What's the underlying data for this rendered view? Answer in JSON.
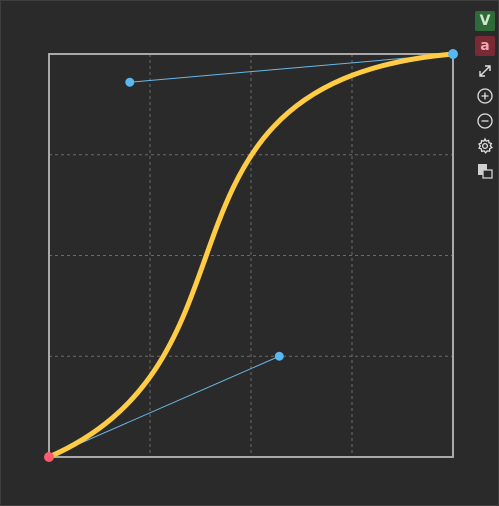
{
  "editor": {
    "title": "",
    "curve": {
      "start_point": [
        0,
        0
      ],
      "end_point": [
        1,
        1
      ],
      "control_1": [
        0.57,
        0.25
      ],
      "control_2": [
        0.2,
        0.93
      ],
      "grid_divisions": 4,
      "curve_color": "#ffcc44",
      "handle_line_color": "#6ab7e6",
      "handle_point_color": "#5ab8f0",
      "start_point_color": "#ff5a6e",
      "frame_color": "#a9a9a9",
      "grid_color": "#6a6a6a"
    }
  },
  "toolbar": {
    "v_label": "V",
    "a_label": "a",
    "icons": [
      "fit-view-icon",
      "zoom-in-icon",
      "zoom-out-icon",
      "settings-icon",
      "layers-icon"
    ]
  }
}
